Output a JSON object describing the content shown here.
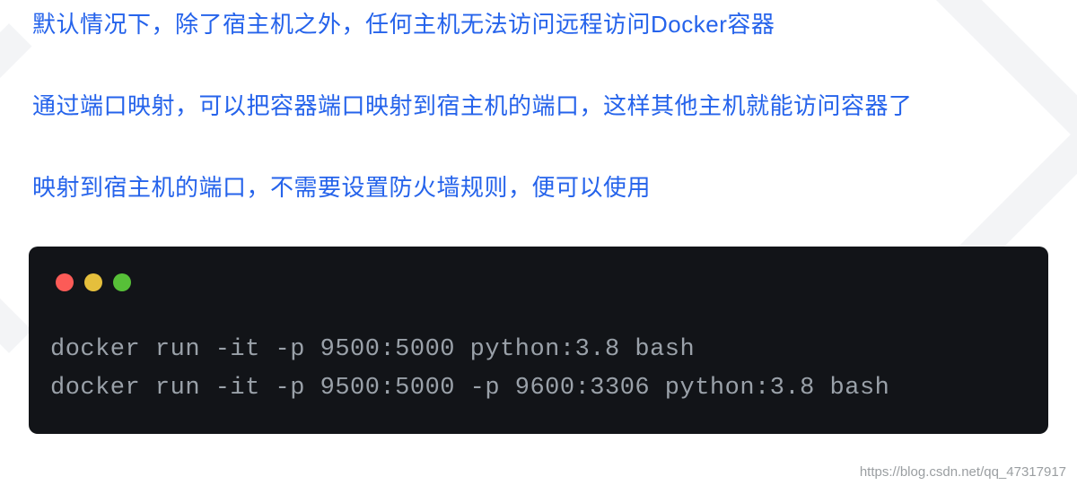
{
  "paragraphs": {
    "p1": "默认情况下，除了宿主机之外，任何主机无法访问远程访问Docker容器",
    "p2": "通过端口映射，可以把容器端口映射到宿主机的端口，这样其他主机就能访问容器了",
    "p3": "映射到宿主机的端口，不需要设置防火墙规则，便可以使用"
  },
  "terminal": {
    "lines": {
      "l1": "docker run -it -p 9500:5000 python:3.8 bash",
      "l2": "docker run -it -p 9500:5000 -p 9600:3306 python:3.8 bash"
    }
  },
  "watermark": "https://blog.csdn.net/qq_47317917",
  "icons": {
    "wm_close": "close",
    "wm_minimize": "minimize",
    "wm_zoom": "zoom"
  }
}
